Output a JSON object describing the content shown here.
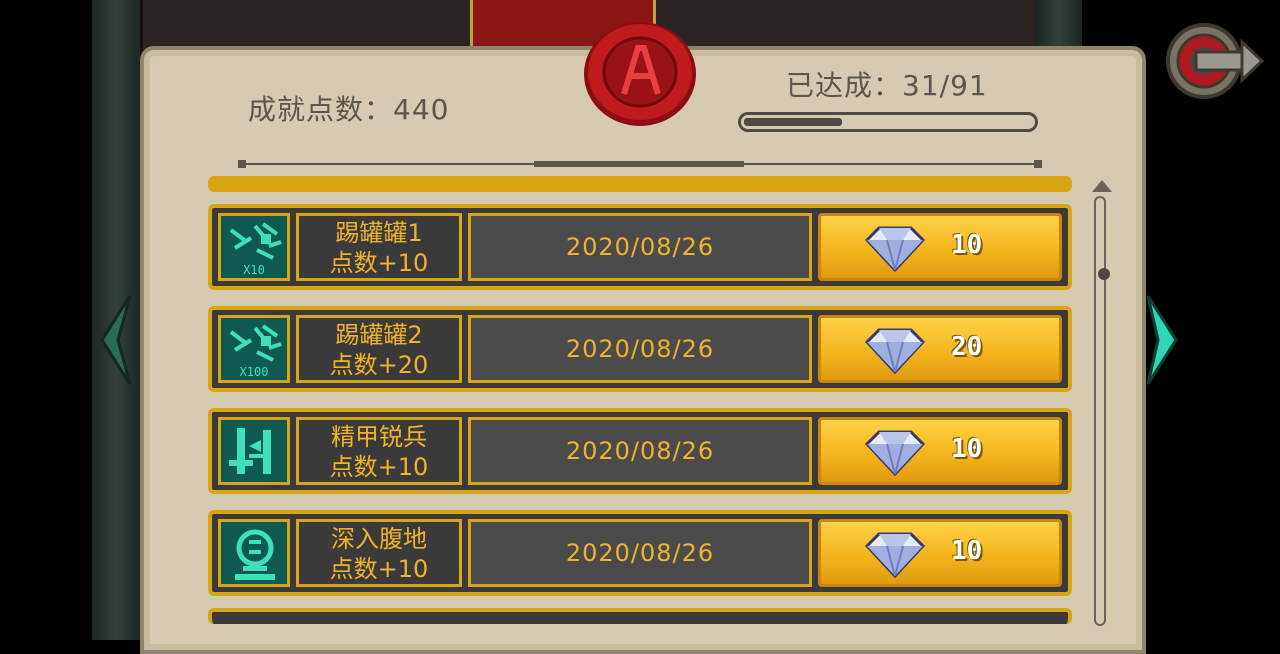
{
  "header": {
    "points_label": "成就点数：440",
    "progress_label": "已达成：31/91",
    "progress_fraction": 0.34
  },
  "achievements": [
    {
      "icon": "kick-cans-icon",
      "badge": "X10",
      "name": "踢罐罐1",
      "points": "点数+10",
      "date": "2020/08/26",
      "reward": "10"
    },
    {
      "icon": "kick-cans-icon",
      "badge": "X100",
      "name": "踢罐罐2",
      "points": "点数+20",
      "date": "2020/08/26",
      "reward": "20"
    },
    {
      "icon": "elite-soldier-icon",
      "badge": "",
      "name": "精甲锐兵",
      "points": "点数+10",
      "date": "2020/08/26",
      "reward": "10"
    },
    {
      "icon": "deep-dive-icon",
      "badge": "",
      "name": "深入腹地",
      "points": "点数+10",
      "date": "2020/08/26",
      "reward": "10"
    }
  ],
  "reward_icon": "diamond-icon",
  "colors": {
    "gold": "#d9a514",
    "teal_icon": "#3ee0b8",
    "seal_red": "#b0161a",
    "parchment": "#d6cbb1"
  }
}
